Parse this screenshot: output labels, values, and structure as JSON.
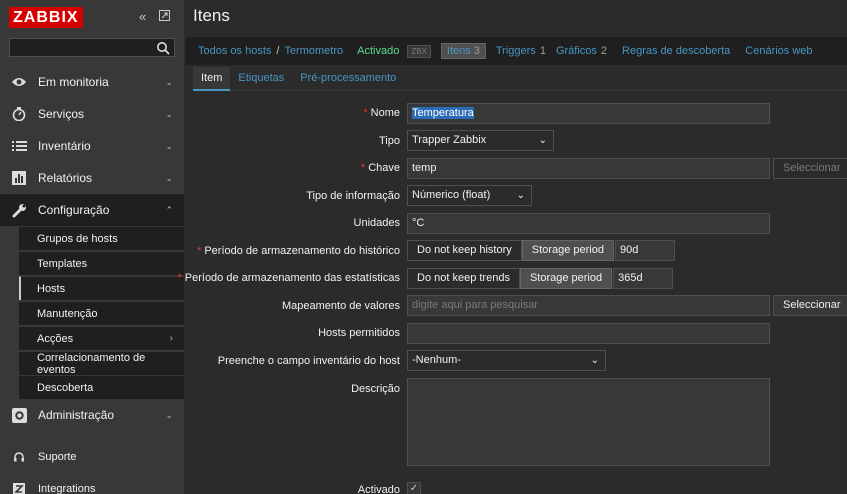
{
  "sidebar": {
    "logo": "ZABBIX",
    "collapse_icon": "double-chevron-left-icon",
    "expand_icon": "expand-icon",
    "search": {
      "value": "",
      "placeholder": ""
    },
    "menu": [
      {
        "label": "Em monitoria",
        "icon": "eye-icon"
      },
      {
        "label": "Serviços",
        "icon": "clock-icon"
      },
      {
        "label": "Inventário",
        "icon": "list-icon"
      },
      {
        "label": "Relatórios",
        "icon": "bar-chart-icon"
      },
      {
        "label": "Configuração",
        "icon": "wrench-icon"
      },
      {
        "label": "Administração",
        "icon": "gear-icon"
      }
    ],
    "config_sub": [
      "Grupos de hosts",
      "Templates",
      "Hosts",
      "Manutenção",
      "Acções",
      "Correlacionamento de eventos",
      "Descoberta"
    ],
    "bottom": [
      {
        "label": "Suporte",
        "icon": "headset-icon"
      },
      {
        "label": "Integrations",
        "icon": "z-icon"
      }
    ]
  },
  "header": {
    "title": "Itens"
  },
  "breadcrumb": {
    "all_hosts": "Todos os hosts",
    "separator": "/",
    "host": "Termometro",
    "status": "Activado",
    "zbx_badge": "ZBX",
    "items": {
      "label": "Itens",
      "count": "3"
    },
    "triggers": {
      "label": "Triggers",
      "count": "1"
    },
    "graphs": {
      "label": "Gráficos",
      "count": "2"
    },
    "discovery": "Regras de descoberta",
    "web": "Cenários web"
  },
  "form_tabs": [
    "Item",
    "Etiquetas",
    "Pré-processamento"
  ],
  "form": {
    "name": {
      "label": "Nome",
      "value": "Temperatura"
    },
    "type": {
      "label": "Tipo",
      "value": "Trapper Zabbix"
    },
    "key": {
      "label": "Chave",
      "value": "temp",
      "button": "Seleccionar"
    },
    "info_type": {
      "label": "Tipo de informação",
      "value": "Númerico (float)"
    },
    "units": {
      "label": "Unidades",
      "value": "°C"
    },
    "history": {
      "label": "Período de armazenamento do histórico",
      "opt1": "Do not keep history",
      "opt2": "Storage period",
      "value": "90d"
    },
    "trends": {
      "label": "Período de armazenamento das estatísticas",
      "opt1": "Do not keep trends",
      "opt2": "Storage period",
      "value": "365d"
    },
    "valuemap": {
      "label": "Mapeamento de valores",
      "placeholder": "digite aqui para pesquisar",
      "button": "Seleccionar"
    },
    "allowed_hosts": {
      "label": "Hosts permitidos",
      "value": ""
    },
    "inventory": {
      "label": "Preenche o campo inventário do host",
      "value": "-Nenhum-"
    },
    "description": {
      "label": "Descrição",
      "value": ""
    },
    "enabled": {
      "label": "Activado",
      "checked": true
    }
  },
  "colors": {
    "accent": "#4796c4",
    "status_green": "#59db8f",
    "required": "#e33734",
    "logo": "#d40000"
  }
}
